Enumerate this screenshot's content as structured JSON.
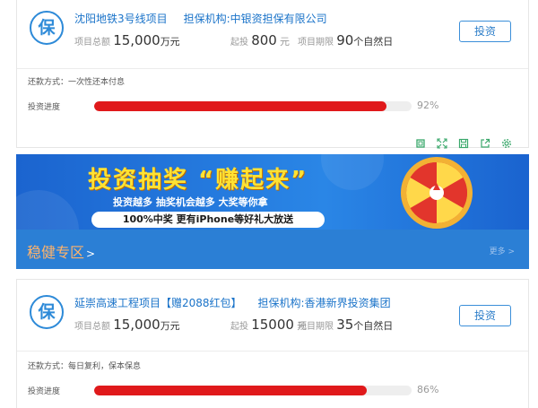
{
  "cards": [
    {
      "badge": "保",
      "title": "沈阳地铁3号线项目",
      "guarantor": "担保机构:中银资担保有限公司",
      "total_label": "项目总额",
      "total_value": "15,000",
      "total_unit": "万元",
      "min_label": "起投",
      "min_value": "800",
      "min_unit": "元",
      "term_label": "项目期限",
      "term_value": "90",
      "term_unit": "个自然日",
      "invest_label": "投资",
      "repay_text": "还款方式：一次性还本付息",
      "progress_label": "投资进度",
      "progress_pct": 92,
      "progress_text": "92%"
    },
    {
      "badge": "保",
      "title": "延崇高速工程项目【赠2088红包】",
      "guarantor": "担保机构:香港新界投资集团",
      "total_label": "项目总额",
      "total_value": "15,000",
      "total_unit": "万元",
      "min_label": "起投",
      "min_value": "15000",
      "min_unit": "元",
      "term_label": "项目期限",
      "term_value": "35",
      "term_unit": "个自然日",
      "invest_label": "投资",
      "repay_text": "还款方式：每日复利，保本保息",
      "progress_label": "投资进度",
      "progress_pct": 86,
      "progress_text": "86%"
    }
  ],
  "toolbar_icons": [
    "crop-icon",
    "expand-icon",
    "save-icon",
    "share-icon",
    "settings-icon"
  ],
  "banner": {
    "title": "投资抽奖 “赚起来”",
    "subtitle": "投资越多 抽奖机会越多 大奖等你拿",
    "pill": "100%中奖 更有iPhone等好礼大放送"
  },
  "section": {
    "title": "稳健专区",
    "arrow": ">",
    "more": "更多 >"
  },
  "colors": {
    "accent_blue": "#2d8ad8",
    "progress_red": "#e0191b",
    "section_bar": "#2b7fd5",
    "section_title": "#ffb36b",
    "banner_title": "#ffe233"
  }
}
